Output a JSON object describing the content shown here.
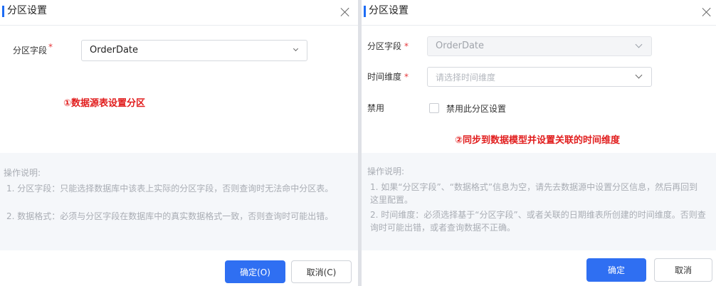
{
  "left_dialog": {
    "title": "分区设置",
    "partition_field": {
      "label": "分区字段",
      "required_mark": "*",
      "value": "OrderDate"
    },
    "annotation": "①数据源表设置分区",
    "notes": {
      "title": "操作说明:",
      "items": [
        "1. 分区字段：只能选择数据库中该表上实际的分区字段，否则查询时无法命中分区表。",
        "2. 数据格式：必须与分区字段在数据库中的真实数据格式一致，否则查询时可能出错。"
      ]
    },
    "buttons": {
      "ok": "确定(O)",
      "cancel": "取消(C)"
    }
  },
  "right_dialog": {
    "title": "分区设置",
    "partition_field": {
      "label": "分区字段",
      "required_mark": "*",
      "value": "OrderDate"
    },
    "time_dimension": {
      "label": "时间维度",
      "required_mark": "*",
      "placeholder": "请选择时间维度"
    },
    "disable": {
      "label": "禁用",
      "checkbox_label": "禁用此分区设置"
    },
    "annotation": "②同步到数据模型并设置关联的时间维度",
    "notes": {
      "title": "操作说明:",
      "items": [
        "1. 如果“分区字段”、“数据格式”信息为空，请先去数据源中设置分区信息，然后再回到这里配置。",
        "2. 时间维度：必须选择基于“分区字段”、或者关联的日期维表所创建的时间维度。否则查询时可能出错，或者查询数据不正确。"
      ]
    },
    "buttons": {
      "ok": "确定",
      "cancel": "取消"
    }
  },
  "colors": {
    "accent": "#2f6ff2",
    "annotation": "#e11d1d",
    "required": "#e5383b"
  }
}
